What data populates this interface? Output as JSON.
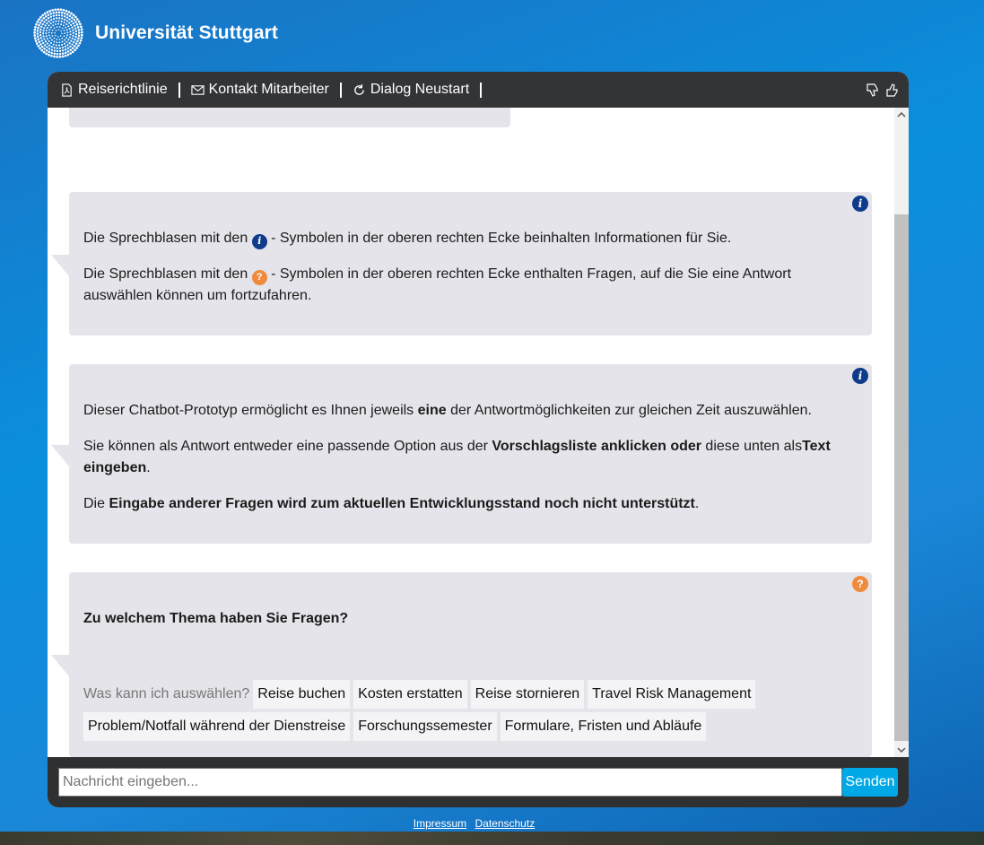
{
  "brand": {
    "name": "Universität Stuttgart"
  },
  "header": {
    "buttons": [
      {
        "label": "Reiserichtlinie",
        "icon": "pdf-icon"
      },
      {
        "label": "Kontakt Mitarbeiter",
        "icon": "mail-icon"
      },
      {
        "label": "Dialog Neustart",
        "icon": "restart-icon"
      }
    ],
    "feedback": {
      "dislike_icon": "thumbs-down-icon",
      "like_icon": "thumbs-up-icon"
    }
  },
  "messages": {
    "m1": {
      "type": "info",
      "badge": "i",
      "p1_before": "Die Sprechblasen mit den ",
      "p1_after": " - Symbolen in der oberen rechten Ecke beinhalten Informationen für Sie.",
      "p2_before": "Die Sprechblasen mit den ",
      "p2_after": " - Symbolen in der oberen rechten Ecke enthalten Fragen, auf die Sie eine Antwort auswählen können um fortzufahren."
    },
    "m2": {
      "type": "info",
      "badge": "i",
      "p1_a": "Dieser Chatbot-Prototyp ermöglicht es Ihnen jeweils ",
      "p1_b": "eine",
      "p1_c": " der Antwortmöglichkeiten zur gleichen Zeit auszuwählen.",
      "p2_a": "Sie können als Antwort entweder eine passende Option aus der ",
      "p2_b": "Vorschlagsliste anklicken oder",
      "p2_c": " diese unten als",
      "p2_d": "Text eingeben",
      "p2_e": ".",
      "p3_a": "Die ",
      "p3_b": "Eingabe anderer Fragen wird zum aktuellen Entwicklungsstand noch nicht unterstützt",
      "p3_c": "."
    },
    "m3": {
      "type": "question",
      "badge": "?",
      "question": "Zu welchem Thema haben Sie Fragen?",
      "options_label": "Was kann ich auswählen?",
      "options": [
        "Reise buchen",
        "Kosten erstatten",
        "Reise stornieren",
        "Travel Risk Management",
        "Problem/Notfall während der Dienstreise",
        "Forschungssemester",
        "Formulare, Fristen und Abläufe"
      ]
    }
  },
  "input": {
    "placeholder": "Nachricht eingeben...",
    "value": ""
  },
  "send": {
    "label": "Senden"
  },
  "footer": {
    "impressum": "Impressum",
    "datenschutz": "Datenschutz"
  },
  "colors": {
    "header_bg": "#333436",
    "bubble_bg": "#e5e4ea",
    "info_badge": "#0e3c8a",
    "question_badge": "#f08a3c",
    "send_button": "#00a8e6"
  }
}
